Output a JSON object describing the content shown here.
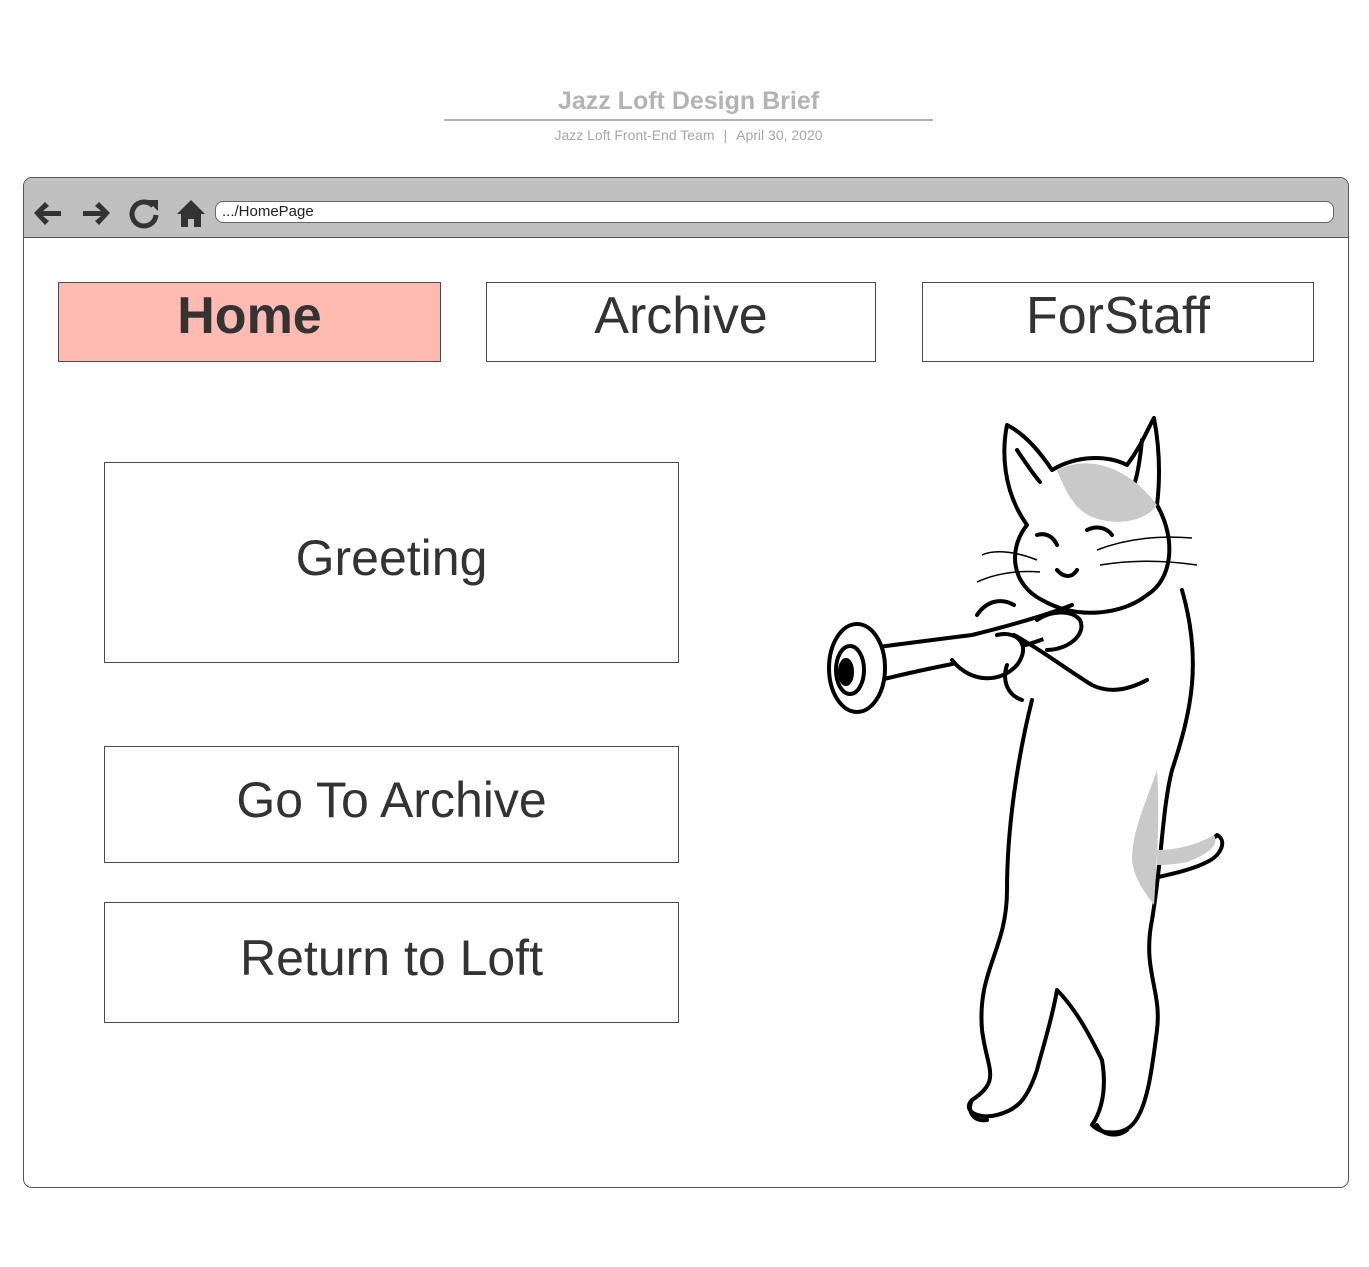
{
  "document": {
    "title": "Jazz Loft Design Brief",
    "team": "Jazz Loft Front-End Team",
    "separator": "|",
    "date": "April 30, 2020"
  },
  "browser": {
    "url": ".../HomePage",
    "icons": [
      "back-arrow-icon",
      "forward-arrow-icon",
      "refresh-icon",
      "home-icon"
    ]
  },
  "nav": {
    "home": "Home",
    "archive": "Archive",
    "staff": "ForStaff",
    "active": "Home",
    "active_color": "#ffbbb1"
  },
  "content": {
    "greeting": "Greeting",
    "go_to_archive": "Go To Archive",
    "return_to_loft": "Return to Loft"
  },
  "illustration": "cat-playing-trumpet"
}
